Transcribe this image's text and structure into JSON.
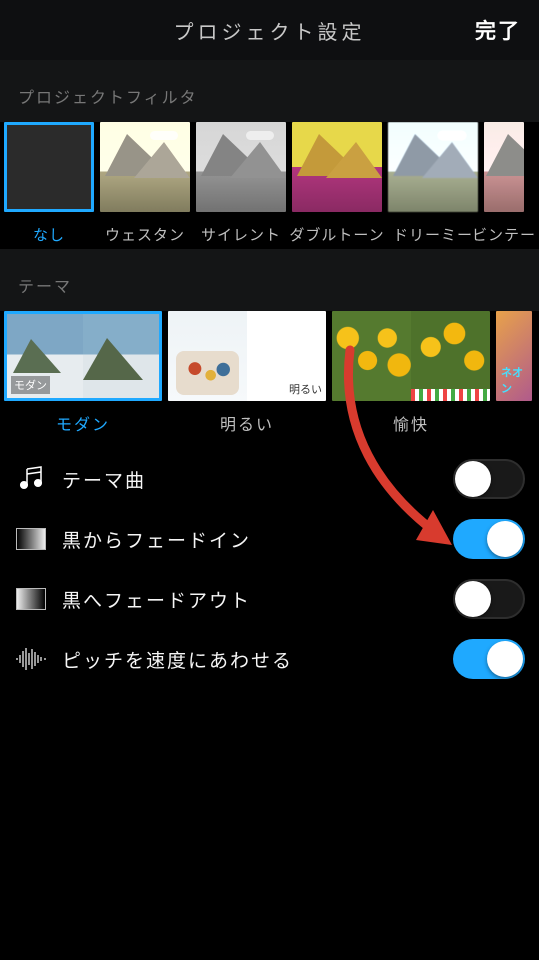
{
  "header": {
    "title": "プロジェクト設定",
    "done": "完了"
  },
  "filters": {
    "section_label": "プロジェクトフィルタ",
    "items": [
      {
        "label": "なし",
        "selected": true
      },
      {
        "label": "ウェスタン"
      },
      {
        "label": "サイレント"
      },
      {
        "label": "ダブルトーン"
      },
      {
        "label": "ドリーミー"
      },
      {
        "label": "ビンテー"
      }
    ]
  },
  "themes": {
    "section_label": "テーマ",
    "items": [
      {
        "label": "モダン",
        "overlay": "モダン",
        "selected": true
      },
      {
        "label": "明るい",
        "overlay": "明るい"
      },
      {
        "label": "愉快",
        "overlay": ""
      },
      {
        "label": "",
        "overlay": "ネオン"
      }
    ]
  },
  "settings": {
    "rows": [
      {
        "icon": "music-icon",
        "label": "テーマ曲",
        "on": false
      },
      {
        "icon": "fade-in-icon",
        "label": "黒からフェードイン",
        "on": true
      },
      {
        "icon": "fade-out-icon",
        "label": "黒へフェードアウト",
        "on": false
      },
      {
        "icon": "waveform-icon",
        "label": "ピッチを速度にあわせる",
        "on": true
      }
    ]
  },
  "colors": {
    "accent": "#1fa9ff",
    "arrow": "#d83b2e"
  }
}
